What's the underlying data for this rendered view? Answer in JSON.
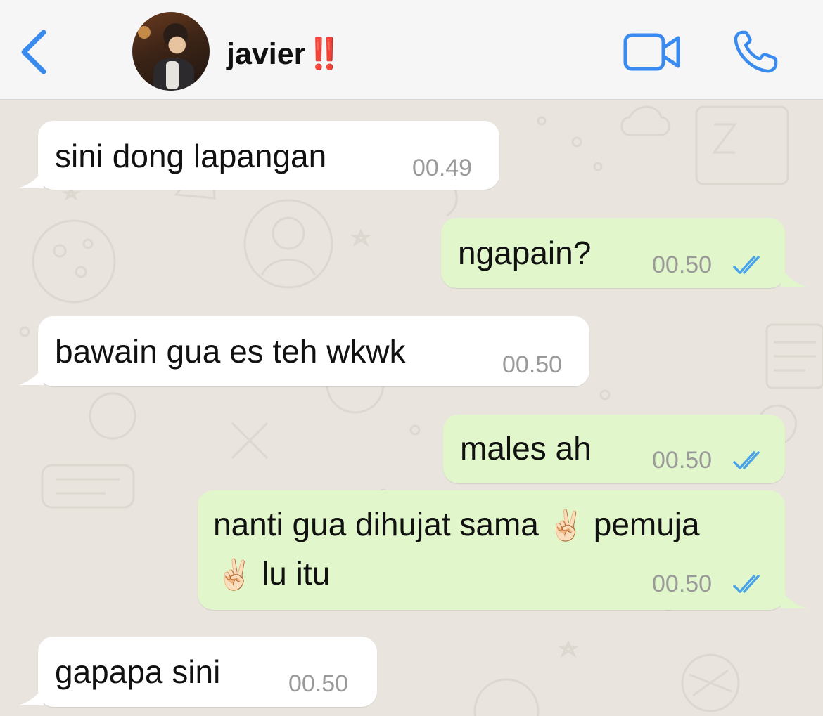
{
  "header": {
    "back_icon": "chevron-left-icon",
    "contact_name": "javier",
    "contact_mark": "‼️",
    "video_icon": "video-camera-icon",
    "call_icon": "phone-icon",
    "accent_color": "#3a8bef"
  },
  "messages": [
    {
      "direction": "incoming",
      "text": "sini dong lapangan",
      "time": "00.49"
    },
    {
      "direction": "outgoing",
      "text": "ngapain?",
      "time": "00.50",
      "status": "read"
    },
    {
      "direction": "incoming",
      "text": "bawain gua es teh wkwk",
      "time": "00.50"
    },
    {
      "direction": "outgoing",
      "text": "males ah",
      "time": "00.50",
      "status": "read"
    },
    {
      "direction": "outgoing",
      "text_line1_a": "nanti gua dihujat sama ",
      "emoji": "✌🏻",
      "text_line1_b": " pemuja",
      "text_line2": " lu itu",
      "time": "00.50",
      "status": "read"
    },
    {
      "direction": "incoming",
      "text": "gapapa sini",
      "time": "00.50"
    }
  ],
  "colors": {
    "incoming_bubble": "#ffffff",
    "outgoing_bubble": "#e1f7cb",
    "read_ticks": "#4aa3e8",
    "chat_background": "#e9e5de"
  }
}
